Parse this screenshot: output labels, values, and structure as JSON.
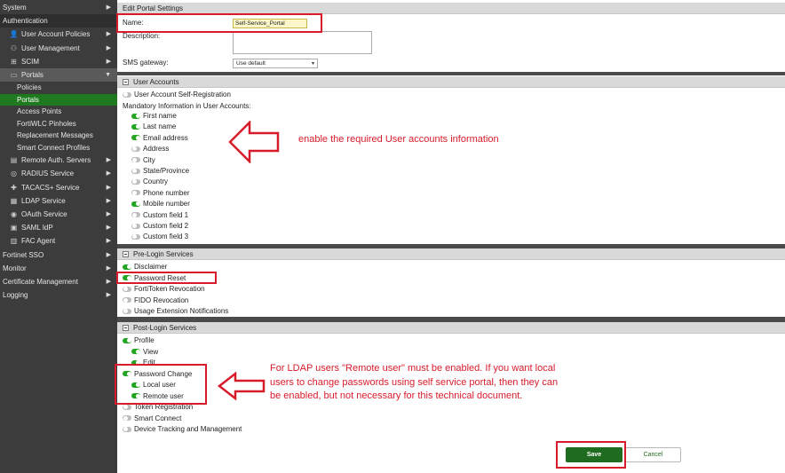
{
  "sidebar": {
    "items": [
      {
        "label": "System",
        "icon": "",
        "level": 0,
        "arrow": "▶"
      },
      {
        "label": "Authentication",
        "icon": "",
        "level": 0,
        "arrow": "",
        "state": "active-group"
      },
      {
        "label": "User Account Policies",
        "icon": "user-policy-icon",
        "level": 1,
        "arrow": "▶"
      },
      {
        "label": "User Management",
        "icon": "users-icon",
        "level": 1,
        "arrow": "▶"
      },
      {
        "label": "SCIM",
        "icon": "scim-icon",
        "level": 1,
        "arrow": "▶"
      },
      {
        "label": "Portals",
        "icon": "portal-icon",
        "level": 1,
        "arrow": "▼",
        "state": "expanded"
      },
      {
        "label": "Policies",
        "icon": "",
        "level": 2,
        "arrow": ""
      },
      {
        "label": "Portals",
        "icon": "",
        "level": 2,
        "arrow": "",
        "state": "selected"
      },
      {
        "label": "Access Points",
        "icon": "",
        "level": 2,
        "arrow": ""
      },
      {
        "label": "FortiWLC Pinholes",
        "icon": "",
        "level": 2,
        "arrow": ""
      },
      {
        "label": "Replacement Messages",
        "icon": "",
        "level": 2,
        "arrow": ""
      },
      {
        "label": "Smart Connect Profiles",
        "icon": "",
        "level": 2,
        "arrow": ""
      },
      {
        "label": "Remote Auth. Servers",
        "icon": "server-icon",
        "level": 1,
        "arrow": "▶"
      },
      {
        "label": "RADIUS Service",
        "icon": "radius-icon",
        "level": 1,
        "arrow": "▶"
      },
      {
        "label": "TACACS+ Service",
        "icon": "tacacs-icon",
        "level": 1,
        "arrow": "▶"
      },
      {
        "label": "LDAP Service",
        "icon": "ldap-icon",
        "level": 1,
        "arrow": "▶"
      },
      {
        "label": "OAuth Service",
        "icon": "oauth-icon",
        "level": 1,
        "arrow": "▶"
      },
      {
        "label": "SAML IdP",
        "icon": "saml-icon",
        "level": 1,
        "arrow": "▶"
      },
      {
        "label": "FAC Agent",
        "icon": "agent-icon",
        "level": 1,
        "arrow": "▶"
      },
      {
        "label": "Fortinet SSO",
        "icon": "",
        "level": 0,
        "arrow": "▶"
      },
      {
        "label": "Monitor",
        "icon": "",
        "level": 0,
        "arrow": "▶"
      },
      {
        "label": "Certificate Management",
        "icon": "",
        "level": 0,
        "arrow": "▶"
      },
      {
        "label": "Logging",
        "icon": "",
        "level": 0,
        "arrow": "▶"
      }
    ]
  },
  "header": {
    "title": "Edit Portal Settings"
  },
  "form": {
    "name_label": "Name:",
    "name_value": "Self-Service_Portal",
    "description_label": "Description:",
    "sms_label": "SMS gateway:",
    "sms_value": "Use default"
  },
  "user_accounts": {
    "title": "User Accounts",
    "self_registration": {
      "label": "User Account Self-Registration",
      "on": false
    },
    "mandatory_label": "Mandatory Information in User Accounts:",
    "fields": [
      {
        "label": "First name",
        "on": true
      },
      {
        "label": "Last name",
        "on": true
      },
      {
        "label": "Email address",
        "on": true
      },
      {
        "label": "Address",
        "on": false
      },
      {
        "label": "City",
        "on": false
      },
      {
        "label": "State/Province",
        "on": false
      },
      {
        "label": "Country",
        "on": false
      },
      {
        "label": "Phone number",
        "on": false
      },
      {
        "label": "Mobile number",
        "on": true
      },
      {
        "label": "Custom field 1",
        "on": false
      },
      {
        "label": "Custom field 2",
        "on": false
      },
      {
        "label": "Custom field 3",
        "on": false
      }
    ]
  },
  "pre_login": {
    "title": "Pre-Login Services",
    "items": [
      {
        "label": "Disclaimer",
        "on": true
      },
      {
        "label": "Password Reset",
        "on": true
      },
      {
        "label": "FortiToken Revocation",
        "on": false
      },
      {
        "label": "FIDO Revocation",
        "on": false
      },
      {
        "label": "Usage Extension Notifications",
        "on": false
      }
    ]
  },
  "post_login": {
    "title": "Post-Login Services",
    "items": [
      {
        "label": "Profile",
        "on": true,
        "indent": 0
      },
      {
        "label": "View",
        "on": true,
        "indent": 1
      },
      {
        "label": "Edit",
        "on": true,
        "indent": 1
      },
      {
        "label": "Password Change",
        "on": true,
        "indent": 0
      },
      {
        "label": "Local user",
        "on": true,
        "indent": 1
      },
      {
        "label": "Remote user",
        "on": true,
        "indent": 1
      },
      {
        "label": "Token Registration",
        "on": false,
        "indent": 0
      },
      {
        "label": "Smart Connect",
        "on": false,
        "indent": 0
      },
      {
        "label": "Device Tracking and Management",
        "on": false,
        "indent": 0
      }
    ]
  },
  "annotations": {
    "user_accounts_note": "enable the required User accounts information",
    "ldap_note_lines": [
      "For LDAP users \"Remote user\" must be enabled. If you want local",
      "users to change passwords using self service portal, then they can",
      "be enabled, but not necessary for this technical document."
    ]
  },
  "buttons": {
    "save": "Save",
    "cancel": "Cancel"
  },
  "colors": {
    "sidebar_bg": "#3c3c3c",
    "selected": "#1f7a1f",
    "toggle_on": "#23a523",
    "annotation_red": "#d81b2b"
  }
}
